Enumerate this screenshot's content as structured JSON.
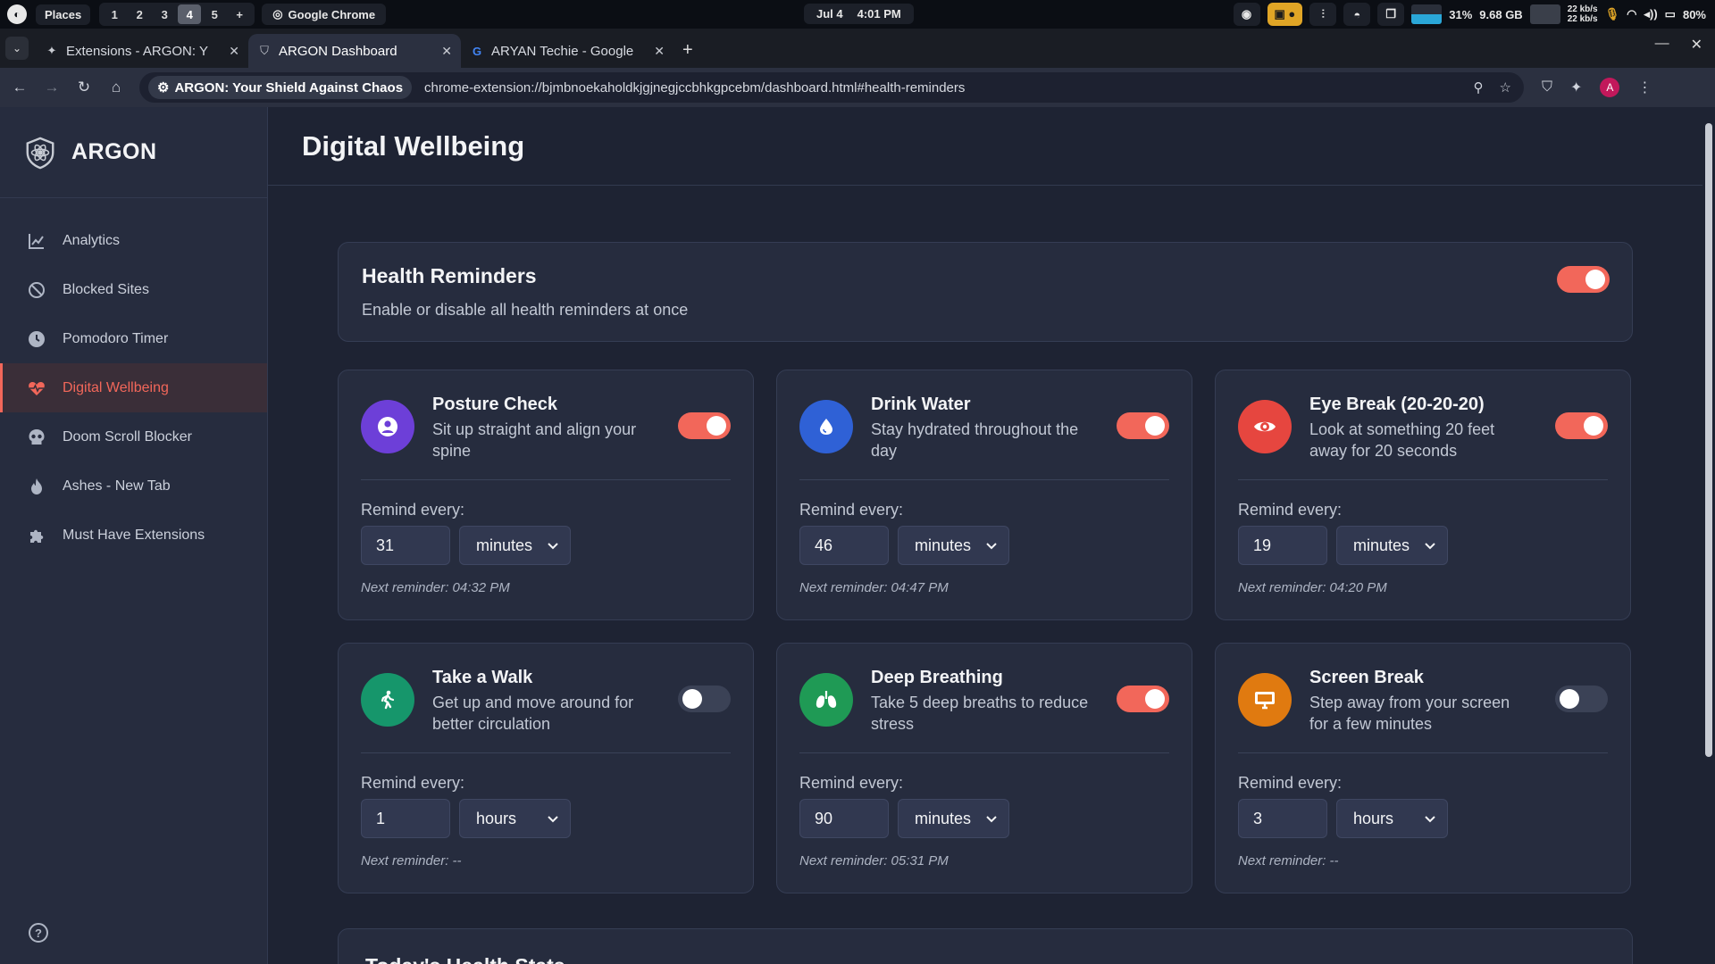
{
  "os": {
    "places": "Places",
    "workspaces": [
      "1",
      "2",
      "3",
      "4",
      "5",
      "+"
    ],
    "active_workspace": "4",
    "app": "Google Chrome",
    "date": "Jul 4",
    "time": "4:01 PM",
    "cpu": "31%",
    "memory": "9.68 GB",
    "net_down": "22 kb/s",
    "net_up": "22 kb/s",
    "battery": "80%"
  },
  "browser": {
    "tabs": [
      {
        "title": "Extensions - ARGON: Y",
        "icon": "puzzle-icon",
        "active": false
      },
      {
        "title": "ARGON Dashboard",
        "icon": "shield-icon",
        "active": true
      },
      {
        "title": "ARYAN Techie - Google",
        "icon": "google-icon",
        "active": false
      }
    ],
    "site_chip": "ARGON: Your Shield Against Chaos",
    "url": "chrome-extension://bjmbnoekaholdkjgjnegjccbhkgpcebm/dashboard.html#health-reminders",
    "avatar_letter": "A"
  },
  "sidebar": {
    "brand": "ARGON",
    "items": [
      {
        "label": "Analytics",
        "icon": "chart-line-icon",
        "active": false
      },
      {
        "label": "Blocked Sites",
        "icon": "ban-icon",
        "active": false
      },
      {
        "label": "Pomodoro Timer",
        "icon": "clock-icon",
        "active": false
      },
      {
        "label": "Digital Wellbeing",
        "icon": "heartbeat-icon",
        "active": true
      },
      {
        "label": "Doom Scroll Blocker",
        "icon": "skull-icon",
        "active": false
      },
      {
        "label": "Ashes - New Tab",
        "icon": "fire-icon",
        "active": false
      },
      {
        "label": "Must Have Extensions",
        "icon": "puzzle-icon",
        "active": false
      }
    ],
    "help": "?"
  },
  "main": {
    "title": "Digital Wellbeing",
    "master": {
      "title": "Health Reminders",
      "description": "Enable or disable all health reminders at once",
      "enabled": true
    },
    "remind_label": "Remind every:",
    "reminders": [
      {
        "title": "Posture Check",
        "description": "Sit up straight and align your spine",
        "enabled": true,
        "value": "31",
        "unit": "minutes",
        "next": "Next reminder: 04:32 PM",
        "icon": "user-circle-icon",
        "color": "#6d3fd8"
      },
      {
        "title": "Drink Water",
        "description": "Stay hydrated throughout the day",
        "enabled": true,
        "value": "46",
        "unit": "minutes",
        "next": "Next reminder: 04:47 PM",
        "icon": "water-drop-icon",
        "color": "#2f61d6"
      },
      {
        "title": "Eye Break (20-20-20)",
        "description": "Look at something 20 feet away for 20 seconds",
        "enabled": true,
        "value": "19",
        "unit": "minutes",
        "next": "Next reminder: 04:20 PM",
        "icon": "eye-icon",
        "color": "#e6463f"
      },
      {
        "title": "Take a Walk",
        "description": "Get up and move around for better circulation",
        "enabled": false,
        "value": "1",
        "unit": "hours",
        "next": "Next reminder: --",
        "icon": "walking-icon",
        "color": "#16966b"
      },
      {
        "title": "Deep Breathing",
        "description": "Take 5 deep breaths to reduce stress",
        "enabled": true,
        "value": "90",
        "unit": "minutes",
        "next": "Next reminder: 05:31 PM",
        "icon": "lungs-icon",
        "color": "#1f9a55"
      },
      {
        "title": "Screen Break",
        "description": "Step away from your screen for a few minutes",
        "enabled": false,
        "value": "3",
        "unit": "hours",
        "next": "Next reminder: --",
        "icon": "monitor-icon",
        "color": "#e07a10"
      }
    ],
    "stats_title": "Today's Health Stats"
  },
  "colors": {
    "accent": "#f2675a",
    "background": "#1e2333",
    "card": "#262c3e"
  }
}
